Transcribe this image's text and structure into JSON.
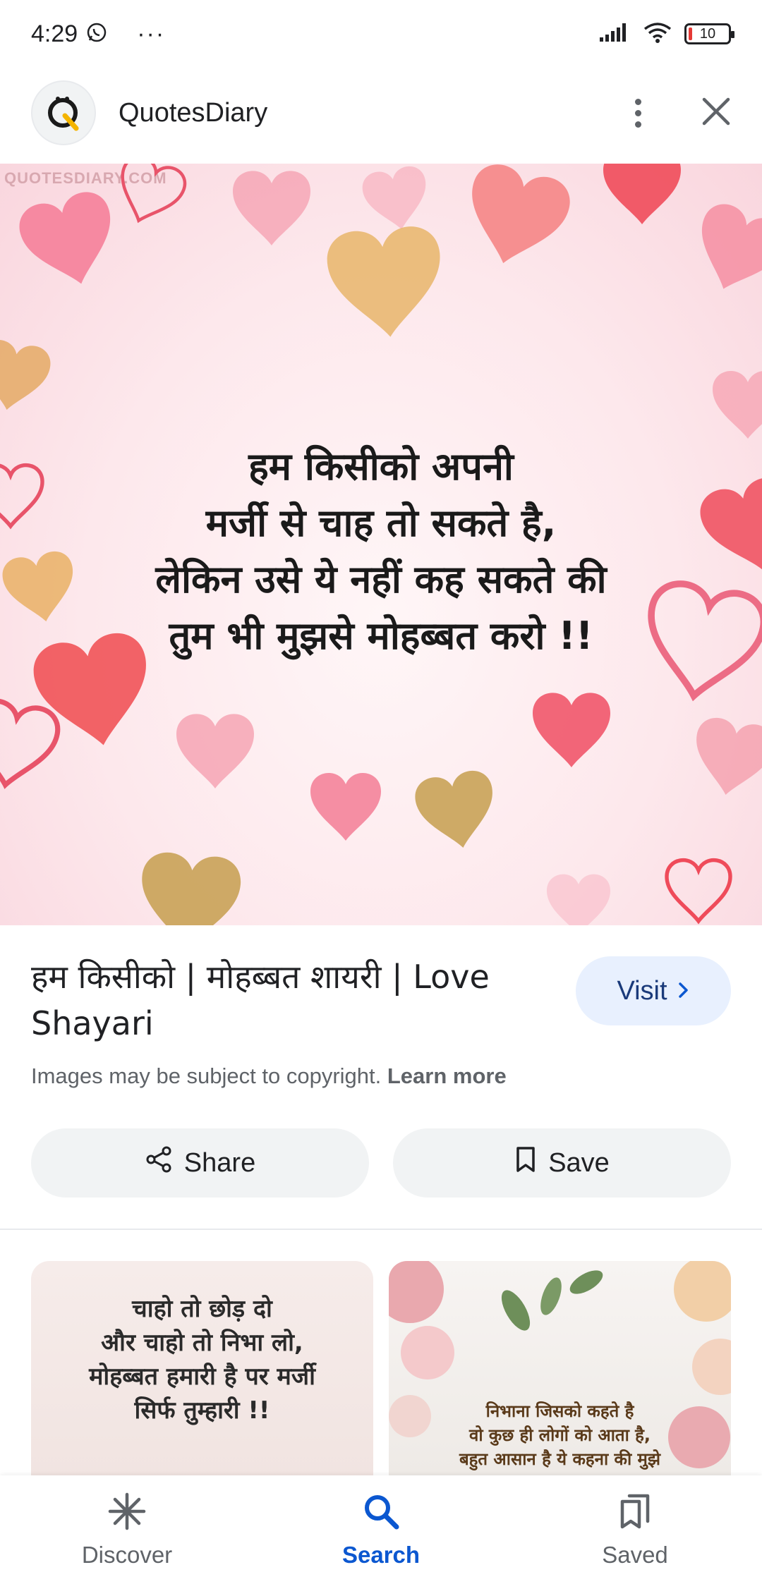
{
  "status_bar": {
    "time": "4:29",
    "more": "···",
    "battery": "10"
  },
  "header": {
    "site_name": "QuotesDiary"
  },
  "hero": {
    "watermark": "QUOTESDIARY.COM",
    "quote": "हम किसीको अपनी\nमर्जी से चाह तो सकते है,\nलेकिन उसे ये नहीं कह सकते की\nतुम भी मुझसे मोहब्बत करो !!"
  },
  "result": {
    "title": "हम किसीको | मोहब्बत शायरी | Love Shayari",
    "visit_label": "Visit",
    "copyright_text": "Images may be subject to copyright. ",
    "learn_more": "Learn more"
  },
  "actions": {
    "share_label": "Share",
    "save_label": "Save"
  },
  "related": [
    {
      "text": "चाहो तो छोड़ दो\nऔर चाहो तो निभा लो,\nमोहब्बत हमारी है पर मर्जी\nसिर्फ तुम्हारी !!"
    },
    {
      "text": "निभाना जिसको कहते है\nवो कुछ ही लोगों को आता है,\nबहुत आसान है ये कहना की मुझे"
    }
  ],
  "bottom_nav": {
    "items": [
      {
        "label": "Discover",
        "icon": "discover-icon"
      },
      {
        "label": "Search",
        "icon": "search-icon",
        "active": true
      },
      {
        "label": "Saved",
        "icon": "saved-icon"
      }
    ]
  },
  "colors": {
    "accent": "#0b57d0",
    "visit_bg": "#e8f0fe",
    "pill_bg": "#f1f3f4"
  }
}
